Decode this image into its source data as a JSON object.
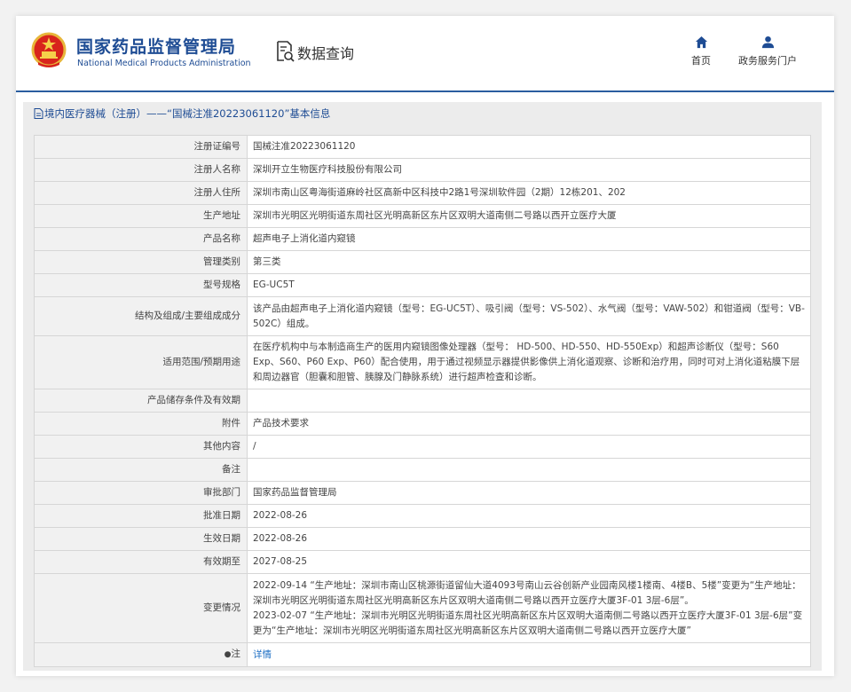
{
  "header": {
    "logo_cn": "国家药品监督管理局",
    "logo_en": "National Medical Products Administration",
    "query_title": "数据查询",
    "nav": [
      {
        "label": "首页",
        "icon": "home-icon"
      },
      {
        "label": "政务服务门户",
        "icon": "user-icon"
      }
    ]
  },
  "panel": {
    "title": "境内医疗器械（注册）——“国械注准20223061120”基本信息"
  },
  "rows": [
    {
      "key": "注册证编号",
      "value": "国械注准20223061120",
      "h": 26
    },
    {
      "key": "注册人名称",
      "value": "深圳开立生物医疗科技股份有限公司",
      "h": 26
    },
    {
      "key": "注册人住所",
      "value": "深圳市南山区粤海街道麻岭社区高新中区科技中2路1号深圳软件园（2期）12栋201、202",
      "h": 26
    },
    {
      "key": "生产地址",
      "value": "深圳市光明区光明街道东周社区光明高新区东片区双明大道南侧二号路以西开立医疗大厦",
      "h": 26
    },
    {
      "key": "产品名称",
      "value": "超声电子上消化道内窥镜",
      "h": 26
    },
    {
      "key": "管理类别",
      "value": "第三类",
      "h": 26
    },
    {
      "key": "型号规格",
      "value": "EG-UC5T",
      "h": 26
    },
    {
      "key": "结构及组成/主要组成成分",
      "value": "该产品由超声电子上消化道内窥镜（型号：EG-UC5T）、吸引阀（型号：VS-502）、水气阀（型号：VAW-502）和钳道阀（型号：VB-502C）组成。",
      "h": 44
    },
    {
      "key": "适用范围/预期用途",
      "value": "在医疗机构中与本制造商生产的医用内窥镜图像处理器（型号： HD-500、HD-550、HD-550Exp）和超声诊断仪（型号：S60 Exp、S60、P60 Exp、P60）配合使用，用于通过视频显示器提供影像供上消化道观察、诊断和治疗用，同时可对上消化道粘膜下层和周边器官（胆囊和胆管、胰腺及门静脉系统）进行超声检查和诊断。",
      "h": 60
    },
    {
      "key": "产品储存条件及有效期",
      "value": "",
      "h": 26
    },
    {
      "key": "附件",
      "value": "产品技术要求",
      "h": 26
    },
    {
      "key": "其他内容",
      "value": "/",
      "h": 26
    },
    {
      "key": "备注",
      "value": "",
      "h": 26
    },
    {
      "key": "审批部门",
      "value": "国家药品监督管理局",
      "h": 26
    },
    {
      "key": "批准日期",
      "value": "2022-08-26",
      "h": 26
    },
    {
      "key": "生效日期",
      "value": "2022-08-26",
      "h": 26
    },
    {
      "key": "有效期至",
      "value": "2027-08-25",
      "h": 26
    }
  ],
  "changes": {
    "key": "变更情况",
    "lines": [
      "2022-09-14 “生产地址：深圳市南山区桃源街道留仙大道4093号南山云谷创新产业园南风楼1楼南、4楼B、5楼”变更为“生产地址：深圳市光明区光明街道东周社区光明高新区东片区双明大道南侧二号路以西开立医疗大厦3F-01 3层-6层”。",
      "2023-02-07 “生产地址：深圳市光明区光明街道东周社区光明高新区东片区双明大道南侧二号路以西开立医疗大厦3F-01 3层-6层”变更为“生产地址：深圳市光明区光明街道东周社区光明高新区东片区双明大道南侧二号路以西开立医疗大厦”"
    ]
  },
  "note": {
    "key": "注",
    "link": "详情"
  }
}
